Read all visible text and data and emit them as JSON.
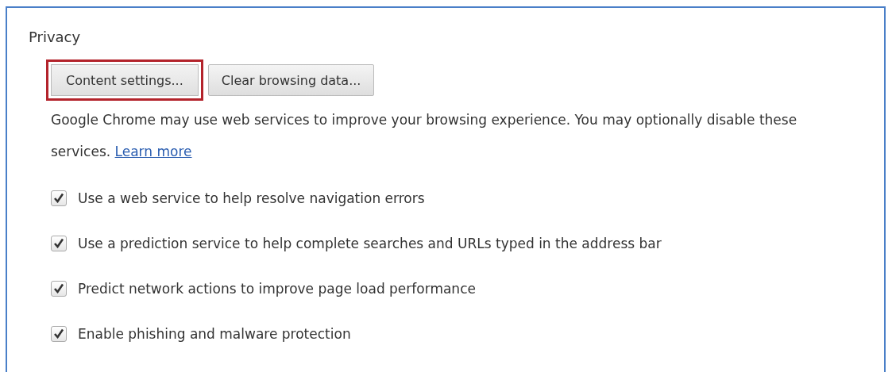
{
  "section": {
    "title": "Privacy",
    "buttons": [
      {
        "label": "Content settings...",
        "highlighted": true
      },
      {
        "label": "Clear browsing data...",
        "highlighted": false
      }
    ],
    "description": "Google Chrome may use web services to improve your browsing experience. You may optionally disable these services.",
    "link": "Learn more",
    "options": [
      {
        "label": "Use a web service to help resolve navigation errors",
        "checked": true
      },
      {
        "label": "Use a prediction service to help complete searches and URLs typed in the address bar",
        "checked": true
      },
      {
        "label": "Predict network actions to improve page load performance",
        "checked": true
      },
      {
        "label": "Enable phishing and malware protection",
        "checked": true
      }
    ]
  }
}
